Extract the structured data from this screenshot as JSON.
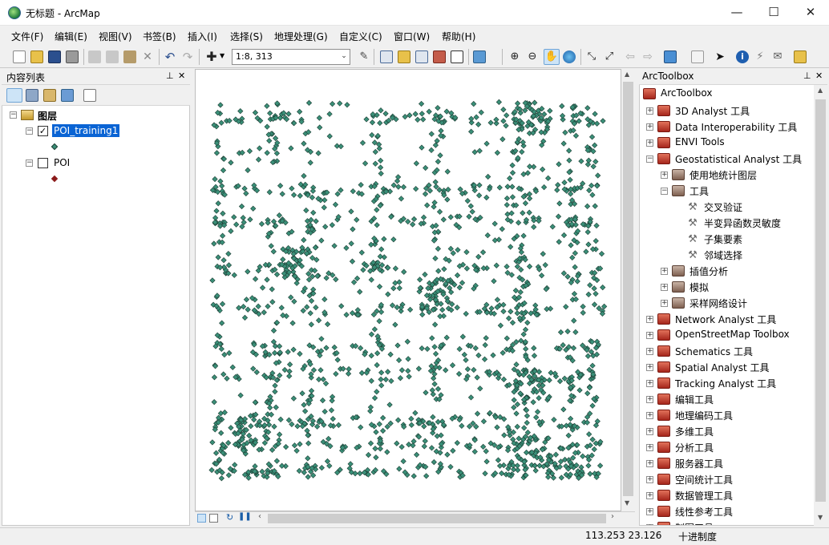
{
  "window": {
    "title": "无标题 - ArcMap",
    "minimize": "—",
    "maximize": "☐",
    "close": "✕"
  },
  "menu": [
    "文件(F)",
    "编辑(E)",
    "视图(V)",
    "书签(B)",
    "插入(I)",
    "选择(S)",
    "地理处理(G)",
    "自定义(C)",
    "窗口(W)",
    "帮助(H)"
  ],
  "toolbar": {
    "scale": "1:8, 313"
  },
  "toc": {
    "title": "内容列表",
    "pin": "⊥",
    "close": "✕",
    "layers_group": "图层",
    "layers": [
      {
        "name": "POI_training1",
        "checked": true,
        "selected": true,
        "color": "#3a8f78"
      },
      {
        "name": "POI",
        "checked": false,
        "selected": false,
        "color": "#8b1a1a"
      }
    ]
  },
  "arctoolbox": {
    "title": "ArcToolbox",
    "pin": "⊥",
    "close": "✕",
    "root": "ArcToolbox",
    "items": [
      {
        "label": "3D Analyst 工具",
        "level": 1,
        "kind": "toolbox",
        "state": "+"
      },
      {
        "label": "Data Interoperability 工具",
        "level": 1,
        "kind": "toolbox",
        "state": "+"
      },
      {
        "label": "ENVI Tools",
        "level": 1,
        "kind": "toolbox",
        "state": "+"
      },
      {
        "label": "Geostatistical Analyst 工具",
        "level": 1,
        "kind": "toolbox",
        "state": "−"
      },
      {
        "label": "使用地统计图层",
        "level": 2,
        "kind": "toolset",
        "state": "+"
      },
      {
        "label": "工具",
        "level": 2,
        "kind": "toolset",
        "state": "−"
      },
      {
        "label": "交叉验证",
        "level": 3,
        "kind": "tool",
        "state": ""
      },
      {
        "label": "半变异函数灵敏度",
        "level": 3,
        "kind": "tool",
        "state": ""
      },
      {
        "label": "子集要素",
        "level": 3,
        "kind": "tool",
        "state": ""
      },
      {
        "label": "邻域选择",
        "level": 3,
        "kind": "tool",
        "state": ""
      },
      {
        "label": "插值分析",
        "level": 2,
        "kind": "toolset",
        "state": "+"
      },
      {
        "label": "模拟",
        "level": 2,
        "kind": "toolset",
        "state": "+"
      },
      {
        "label": "采样网络设计",
        "level": 2,
        "kind": "toolset",
        "state": "+"
      },
      {
        "label": "Network Analyst 工具",
        "level": 1,
        "kind": "toolbox",
        "state": "+"
      },
      {
        "label": "OpenStreetMap Toolbox",
        "level": 1,
        "kind": "toolbox",
        "state": "+"
      },
      {
        "label": "Schematics 工具",
        "level": 1,
        "kind": "toolbox",
        "state": "+"
      },
      {
        "label": "Spatial Analyst 工具",
        "level": 1,
        "kind": "toolbox",
        "state": "+"
      },
      {
        "label": "Tracking Analyst 工具",
        "level": 1,
        "kind": "toolbox",
        "state": "+"
      },
      {
        "label": "编辑工具",
        "level": 1,
        "kind": "toolbox",
        "state": "+"
      },
      {
        "label": "地理编码工具",
        "level": 1,
        "kind": "toolbox",
        "state": "+"
      },
      {
        "label": "多维工具",
        "level": 1,
        "kind": "toolbox",
        "state": "+"
      },
      {
        "label": "分析工具",
        "level": 1,
        "kind": "toolbox",
        "state": "+"
      },
      {
        "label": "服务器工具",
        "level": 1,
        "kind": "toolbox",
        "state": "+"
      },
      {
        "label": "空间统计工具",
        "level": 1,
        "kind": "toolbox",
        "state": "+"
      },
      {
        "label": "数据管理工具",
        "level": 1,
        "kind": "toolbox",
        "state": "+"
      },
      {
        "label": "线性参考工具",
        "level": 1,
        "kind": "toolbox",
        "state": "+"
      },
      {
        "label": "制图工具",
        "level": 1,
        "kind": "toolbox",
        "state": "+"
      }
    ]
  },
  "map": {
    "point_color": "#3a8f78",
    "point_outline": "#1d3d33"
  },
  "status": {
    "coords": "113.253  23.126",
    "unit": "十进制度"
  }
}
